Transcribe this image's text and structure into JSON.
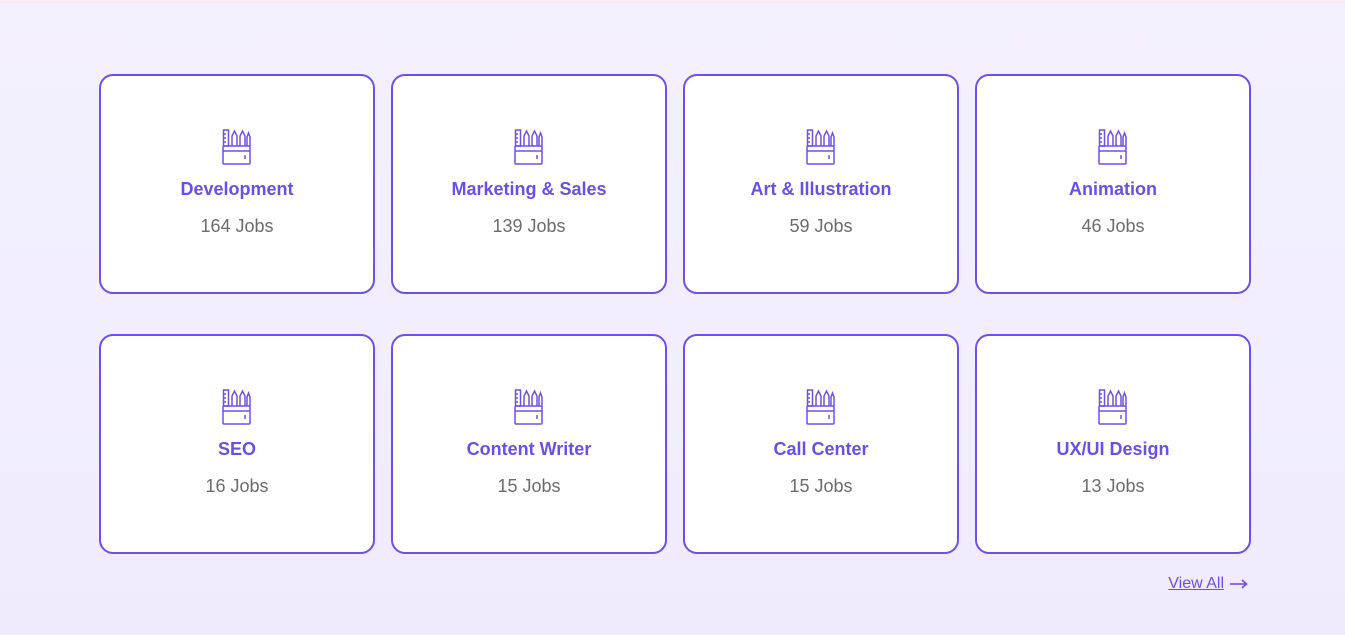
{
  "categories": [
    {
      "title": "Development",
      "count": "164 Jobs",
      "icon": "pencil-case-icon"
    },
    {
      "title": "Marketing & Sales",
      "count": "139 Jobs",
      "icon": "pencil-case-icon"
    },
    {
      "title": "Art & Illustration",
      "count": "59 Jobs",
      "icon": "pencil-case-icon"
    },
    {
      "title": "Animation",
      "count": "46 Jobs",
      "icon": "pencil-case-icon"
    },
    {
      "title": "SEO",
      "count": "16 Jobs",
      "icon": "pencil-case-icon"
    },
    {
      "title": "Content Writer",
      "count": "15 Jobs",
      "icon": "pencil-case-icon"
    },
    {
      "title": "Call Center",
      "count": "15 Jobs",
      "icon": "pencil-case-icon"
    },
    {
      "title": "UX/UI Design",
      "count": "13 Jobs",
      "icon": "pencil-case-icon"
    }
  ],
  "view_all": {
    "label": "View All",
    "icon": "arrow-right-icon"
  },
  "colors": {
    "accent": "#6a4fe6",
    "card_border": "#6e50e6",
    "count_text": "#6b6b6b",
    "background": "#f2eefe"
  }
}
